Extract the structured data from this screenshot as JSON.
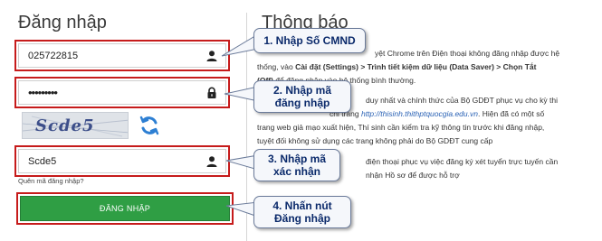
{
  "login": {
    "title": "Đăng nhập",
    "cmnd_value": "025722815",
    "password_value": "•••••••••",
    "captcha_image_text": "Scde5",
    "captcha_value": "Scde5",
    "forgot_label": "Quên mã đăng nhập?",
    "submit_label": "ĐĂNG NHẬP"
  },
  "notice": {
    "title": "Thông báo",
    "p1a": "yệt Chrome trên Điện thoại không đăng nhập được hệ",
    "p1b_pre": "thống, vào ",
    "p1b_bold": "Cài đặt (Settings) > Trình tiết kiệm dữ liệu (Data Saver) > Chọn Tắt",
    "p1c_bold": "(Off)",
    "p1c_rest": " để đăng nhập vào hệ thống bình thường.",
    "p2a": "duy nhất và chính thức của Bộ GDĐT phục vụ cho kỳ thi",
    "p2b_pre": "chỉ trang ",
    "p2b_link": "http://thisinh.thithptquocgia.edu.vn",
    "p2b_post": ". Hiện đã có một số",
    "p2c": "trang web giả mạo xuất hiện, Thí sinh cần kiểm tra kỹ thông tin trước khi đăng nhập,",
    "p2d": "tuyệt đối không sử dụng các trang không phải do Bộ GDĐT cung cấp",
    "p3a": "điện thoại phục vụ việc đăng ký xét tuyển trực tuyến cần",
    "p3b": "nhận Hồ sơ để được hỗ trợ"
  },
  "callouts": {
    "c1": "1. Nhập Số CMND",
    "c2": "2. Nhập mã đăng nhập",
    "c3": "3. Nhập mã xác nhận",
    "c4": "4. Nhấn nút Đăng nhập"
  },
  "icons": {
    "user": "user-icon",
    "lock": "lock-icon",
    "refresh": "refresh-icon"
  },
  "colors": {
    "highlight": "#c61b1b",
    "button": "#2f9e44",
    "callout_text": "#0b2a6b",
    "link": "#2a62b5"
  }
}
